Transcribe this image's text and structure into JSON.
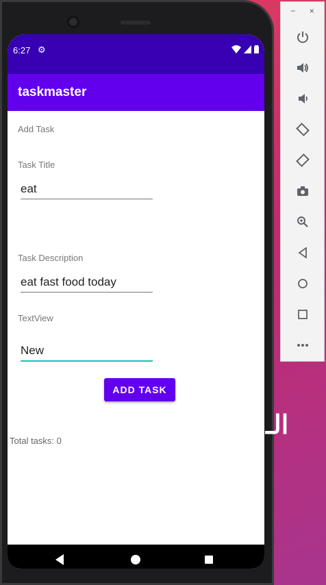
{
  "status_bar": {
    "time": "6:27"
  },
  "app_bar": {
    "title": "taskmaster"
  },
  "form": {
    "header": "Add Task",
    "title_label": "Task Title",
    "title_value": "eat",
    "description_label": "Task Description",
    "description_value": "eat fast food today",
    "textview_label": "TextView",
    "state_value": "New",
    "add_button": "ADD TASK",
    "total_text": "Total tasks: 0"
  },
  "emulator_panel": {
    "window_controls": [
      "−",
      "×"
    ],
    "buttons": [
      "power-icon",
      "volume-up-icon",
      "volume-down-icon",
      "rotate-left-icon",
      "rotate-right-icon",
      "camera-icon",
      "zoom-icon",
      "back-icon",
      "home-icon",
      "overview-icon",
      "more-icon"
    ]
  },
  "watermark": {
    "text": "الـ"
  },
  "colors": {
    "status_bar": "#3700b3",
    "app_bar": "#6200ee",
    "accent": "#14c4b8"
  }
}
